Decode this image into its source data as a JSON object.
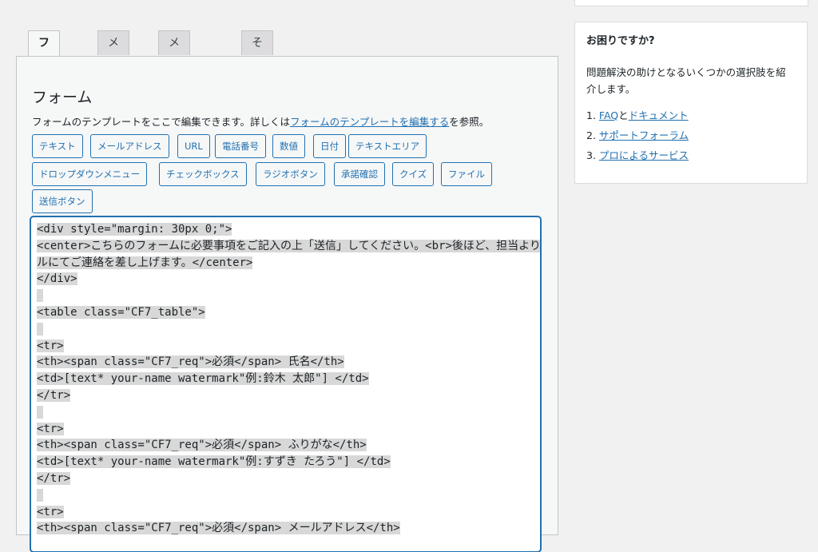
{
  "tabs": [
    {
      "label": "フォーム"
    },
    {
      "label": "メール"
    },
    {
      "label": "メッセージ"
    },
    {
      "label": "その他の設定"
    }
  ],
  "panel": {
    "title": "フォーム",
    "desc_prefix": "フォームのテンプレートをここで編集できます。詳しくは",
    "desc_link": "フォームのテンプレートを編集する",
    "desc_suffix": "を参照。"
  },
  "tag_buttons": [
    "テキスト",
    "メールアドレス",
    "URL",
    "電話番号",
    "数値",
    "日付",
    "テキストエリア",
    "ドロップダウンメニュー",
    "チェックボックス",
    "ラジオボタン",
    "承諾確認",
    "クイズ",
    "ファイル",
    "送信ボタン"
  ],
  "editor": {
    "lines": [
      "<div style=\"margin: 30px 0;\">",
      "<center>こちらのフォームに必要事項をご記入の上「送信」してください。<br>後ほど、担当よりメー",
      "ルにてご連絡を差し上げます。</center>",
      "</div>",
      "",
      "<table class=\"CF7_table\">",
      "",
      "<tr>",
      "<th><span class=\"CF7_req\">必須</span> 氏名</th>",
      "<td>[text* your-name watermark\"例:鈴木 太郎\"] </td>",
      "</tr>",
      "",
      "<tr>",
      "<th><span class=\"CF7_req\">必須</span> ふりがな</th>",
      "<td>[text* your-name watermark\"例:すずき たろう\"] </td>",
      "</tr>",
      "",
      "<tr>",
      "<th><span class=\"CF7_req\">必須</span> メールアドレス</th>"
    ]
  },
  "help": {
    "title": "お困りですか?",
    "text": "問題解決の助けとなるいくつかの選択肢を紹介します。",
    "items": [
      {
        "num": "1.",
        "link": "FAQ",
        "mid": "と",
        "link2": "ドキュメント"
      },
      {
        "num": "2.",
        "link": "サポートフォーラム"
      },
      {
        "num": "3.",
        "link": "プロによるサービス"
      }
    ]
  }
}
